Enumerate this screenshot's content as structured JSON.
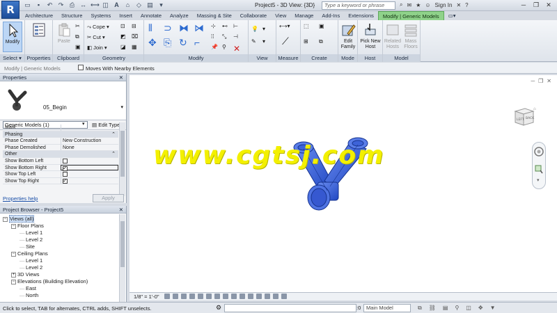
{
  "app": {
    "window_title": "Project5 - 3D View: {3D}",
    "search_placeholder": "Type a keyword or phrase",
    "sign_in": "Sign In"
  },
  "tabs": [
    "Architecture",
    "Structure",
    "Systems",
    "Insert",
    "Annotate",
    "Analyze",
    "Massing & Site",
    "Collaborate",
    "View",
    "Manage",
    "Add-Ins",
    "Extensions",
    "Modify | Generic Models"
  ],
  "active_tab": "Modify | Generic Models",
  "ribbon": {
    "select": {
      "button": "Modify",
      "label": "Select ▾"
    },
    "properties": {
      "label": "Properties"
    },
    "clipboard": {
      "paste": "Paste",
      "label": "Clipboard"
    },
    "geometry": {
      "cope": "Cope",
      "cut": "Cut",
      "join": "Join",
      "label": "Geometry"
    },
    "modify": {
      "label": "Modify"
    },
    "view": {
      "label": "View"
    },
    "measure": {
      "label": "Measure"
    },
    "create": {
      "label": "Create"
    },
    "mode": {
      "edit_family": "Edit Family",
      "label": "Mode"
    },
    "host": {
      "pick_new_host": "Pick New Host",
      "label": "Host"
    },
    "model": {
      "related_hosts": "Related Hosts",
      "mass_floors": "Mass Floors",
      "label": "Model"
    }
  },
  "options_bar": {
    "context": "Modify | Generic Models",
    "moves_with_nearby": "Moves With Nearby Elements"
  },
  "properties": {
    "title": "Properties",
    "type_name": "05_Begin",
    "filter": "Generic Models (1)",
    "edit_type": "Edit Type",
    "rows": [
      {
        "key": "Mark",
        "value": "",
        "kind": "text"
      },
      {
        "key": "Phasing",
        "kind": "group"
      },
      {
        "key": "Phase Created",
        "value": "New Construction",
        "kind": "text"
      },
      {
        "key": "Phase Demolished",
        "value": "None",
        "kind": "text"
      },
      {
        "key": "Other",
        "kind": "group"
      },
      {
        "key": "Show Bottom Left",
        "checked": false,
        "kind": "check"
      },
      {
        "key": "Show Bottom Right",
        "checked": true,
        "kind": "check",
        "selected": true
      },
      {
        "key": "Show Top Left",
        "checked": false,
        "kind": "check"
      },
      {
        "key": "Show Top Right",
        "checked": true,
        "kind": "check"
      }
    ],
    "help": "Properties help",
    "apply": "Apply"
  },
  "project_browser": {
    "title": "Project Browser - Project5",
    "nodes": [
      {
        "label": "Views (all)",
        "depth": 0,
        "toggle": "−",
        "highlight": true
      },
      {
        "label": "Floor Plans",
        "depth": 1,
        "toggle": "−"
      },
      {
        "label": "Level 1",
        "depth": 2
      },
      {
        "label": "Level 2",
        "depth": 2
      },
      {
        "label": "Site",
        "depth": 2
      },
      {
        "label": "Ceiling Plans",
        "depth": 1,
        "toggle": "−"
      },
      {
        "label": "Level 1",
        "depth": 2
      },
      {
        "label": "Level 2",
        "depth": 2
      },
      {
        "label": "3D Views",
        "depth": 1,
        "toggle": "+"
      },
      {
        "label": "Elevations (Building Elevation)",
        "depth": 1,
        "toggle": "−"
      },
      {
        "label": "East",
        "depth": 2
      },
      {
        "label": "North",
        "depth": 2
      }
    ]
  },
  "canvas": {
    "watermark": "www.cgtsj.com",
    "viewcube_left": "LEFT",
    "viewcube_back": "BACK",
    "model_color": "#2b5fd9"
  },
  "view_control": {
    "scale": "1/8\" = 1'-0\""
  },
  "status": {
    "message": "Click to select, TAB for alternates, CTRL adds, SHIFT unselects.",
    "zero": ":0",
    "model": "Main Model"
  }
}
